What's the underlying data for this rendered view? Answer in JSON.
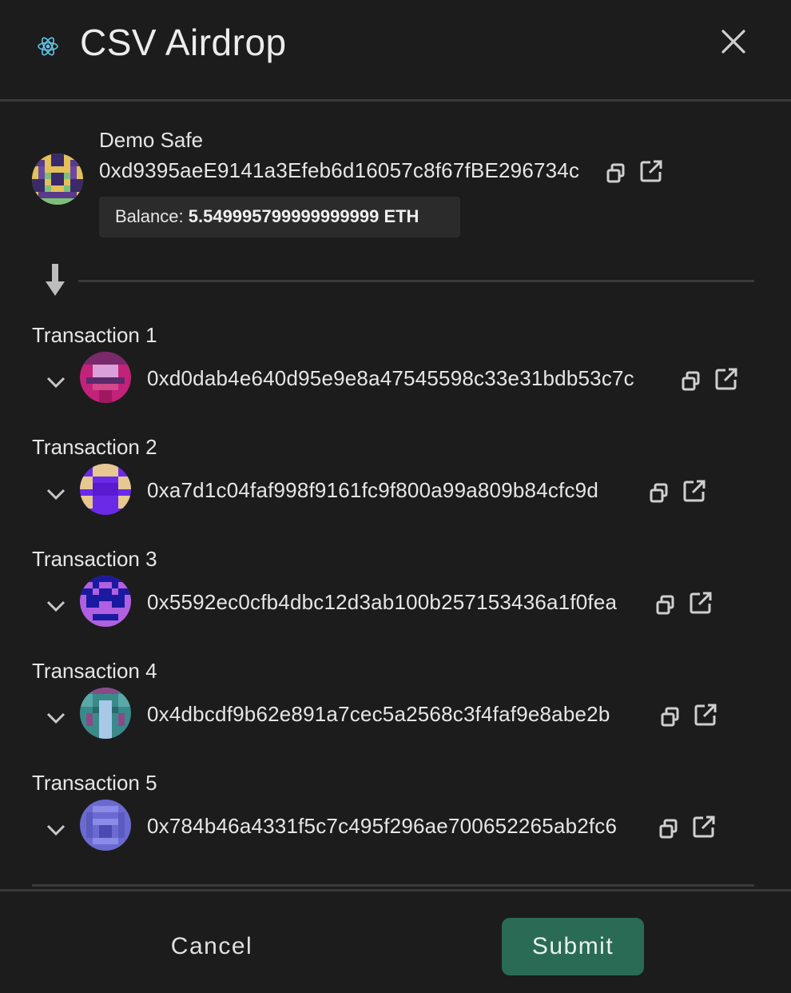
{
  "header": {
    "title": "CSV Airdrop",
    "app_icon": "react-atom-icon",
    "close_icon": "close-icon"
  },
  "safe": {
    "name": "Demo Safe",
    "address": "0xd9395aeE9141a3Efeb6d16057c8f67fBE296734c",
    "balance_label": "Balance:",
    "balance_value": "5.549995799999999999 ETH"
  },
  "transactions": [
    {
      "label": "Transaction 1",
      "address": "0xd0dab4e640d95e9e8a47545598c33e31bdb53c7c"
    },
    {
      "label": "Transaction 2",
      "address": "0xa7d1c04faf998f9161fc9f800a99a809b84cfc9d"
    },
    {
      "label": "Transaction 3",
      "address": "0x5592ec0cfb4dbc12d3ab100b257153436a1f0fea"
    },
    {
      "label": "Transaction 4",
      "address": "0x4dbcdf9b62e891a7cec5a2568c3f4faf9e8abe2b"
    },
    {
      "label": "Transaction 5",
      "address": "0x784b46a4331f5c7c495f296ae700652265ab2fc6"
    }
  ],
  "footer": {
    "cancel_label": "Cancel",
    "submit_label": "Submit"
  },
  "colors": {
    "background": "#1c1c1c",
    "accent": "#2a6b55",
    "balance_box": "#2b2b2b",
    "divider": "#3a3a3a"
  }
}
